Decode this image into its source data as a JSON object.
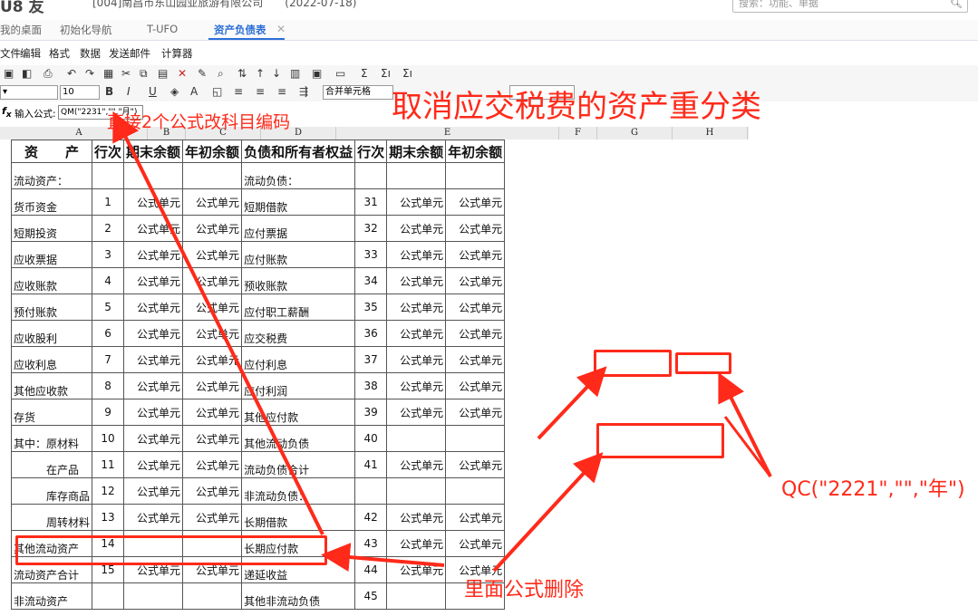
{
  "app": {
    "title": "U8 友",
    "company": "[004]南昌市东山园亚旅游有限公司",
    "date": "(2022-07-18)",
    "search_placeholder": "搜索：功能、单据"
  },
  "tabs": [
    {
      "label": "我的桌面",
      "active": false
    },
    {
      "label": "初始化导航",
      "active": false
    },
    {
      "label": "T-UFO",
      "active": false
    },
    {
      "label": "资产负债表",
      "active": true
    }
  ],
  "menu": [
    "文件",
    "编辑",
    "格式",
    "数据",
    "发送邮件",
    "计算器"
  ],
  "toolbar": {
    "font_size": "10",
    "merge_label": "合并单元格",
    "bold": "B",
    "italic": "I",
    "underline": "U"
  },
  "formula": {
    "label": "输入公式:",
    "value": "QM(\"2231\",\"\",\"月\")"
  },
  "columns": [
    "A",
    "B",
    "C",
    "D",
    "E",
    "F",
    "G",
    "H"
  ],
  "header": {
    "assets": "资　　产",
    "line": "行次",
    "end": "期末余额",
    "begin": "年初余额",
    "liab": "负债和所有者权益",
    "line2": "行次",
    "end2": "期末余额",
    "begin2": "年初余额"
  },
  "rows": [
    {
      "a": "流动资产：",
      "b": "",
      "c": "",
      "d": "",
      "e": "流动负债：",
      "f": "",
      "g": "",
      "h": ""
    },
    {
      "a": "货币资金",
      "b": "1",
      "c": "公式单元",
      "d": "公式单元",
      "e": "短期借款",
      "f": "31",
      "g": "公式单元",
      "h": "公式单元"
    },
    {
      "a": "短期投资",
      "b": "2",
      "c": "公式单元",
      "d": "公式单元",
      "e": "应付票据",
      "f": "32",
      "g": "公式单元",
      "h": "公式单元"
    },
    {
      "a": "应收票据",
      "b": "3",
      "c": "公式单元",
      "d": "公式单元",
      "e": "应付账款",
      "f": "33",
      "g": "公式单元",
      "h": "公式单元"
    },
    {
      "a": "应收账款",
      "b": "4",
      "c": "公式单元",
      "d": "公式单元",
      "e": "预收账款",
      "f": "34",
      "g": "公式单元",
      "h": "公式单元"
    },
    {
      "a": "预付账款",
      "b": "5",
      "c": "公式单元",
      "d": "公式单元",
      "e": "应付职工薪酬",
      "f": "35",
      "g": "公式单元",
      "h": "公式单元"
    },
    {
      "a": "应收股利",
      "b": "6",
      "c": "公式单元",
      "d": "公式单元",
      "e": "应交税费",
      "f": "36",
      "g": "公式单元",
      "h": "公式单元"
    },
    {
      "a": "应收利息",
      "b": "7",
      "c": "公式单元",
      "d": "公式单元",
      "e": "应付利息",
      "f": "37",
      "g": "公式单元",
      "h": "公式单元"
    },
    {
      "a": "其他应收款",
      "b": "8",
      "c": "公式单元",
      "d": "公式单元",
      "e": "应付利润",
      "f": "38",
      "g": "公式单元",
      "h": "公式单元"
    },
    {
      "a": "存货",
      "b": "9",
      "c": "公式单元",
      "d": "公式单元",
      "e": "其他应付款",
      "f": "39",
      "g": "公式单元",
      "h": "公式单元"
    },
    {
      "a": "其中：原材料",
      "b": "10",
      "c": "公式单元",
      "d": "公式单元",
      "e": "其他流动负债",
      "f": "40",
      "g": "",
      "h": ""
    },
    {
      "a": "　　　在产品",
      "b": "11",
      "c": "公式单元",
      "d": "公式单元",
      "e": "流动负债合计",
      "f": "41",
      "g": "公式单元",
      "h": "公式单元"
    },
    {
      "a": "　　　库存商品",
      "b": "12",
      "c": "公式单元",
      "d": "公式单元",
      "e": "非流动负债：",
      "f": "",
      "g": "",
      "h": ""
    },
    {
      "a": "　　　周转材料",
      "b": "13",
      "c": "公式单元",
      "d": "公式单元",
      "e": "长期借款",
      "f": "42",
      "g": "公式单元",
      "h": "公式单元"
    },
    {
      "a": "其他流动资产",
      "b": "14",
      "c": "",
      "d": "",
      "e": "长期应付款",
      "f": "43",
      "g": "公式单元",
      "h": "公式单元"
    },
    {
      "a": "流动资产合计",
      "b": "15",
      "c": "公式单元",
      "d": "公式单元",
      "e": "递延收益",
      "f": "44",
      "g": "公式单元",
      "h": "公式单元"
    },
    {
      "a": "非流动资产",
      "b": "",
      "c": "",
      "d": "",
      "e": "其他非流动负债",
      "f": "45",
      "g": "",
      "h": ""
    }
  ],
  "row_numbers": [
    "",
    "",
    "",
    "",
    "",
    "",
    "",
    "",
    "",
    "0",
    "",
    "2",
    "",
    "4",
    "5",
    "",
    "7",
    "",
    "9",
    "",
    "1"
  ],
  "annotations": {
    "formula_note": "直接2个公式改科目编码",
    "title_note": "取消应交税费的资产重分类",
    "qc_note": "QC(\"2221\",\"\",\"年\")",
    "delete_note": "里面公式删除"
  },
  "colors": {
    "annotation": "#ff2a1a",
    "formula_green": "#1f9a28",
    "active_tab": "#2b6fd6"
  }
}
